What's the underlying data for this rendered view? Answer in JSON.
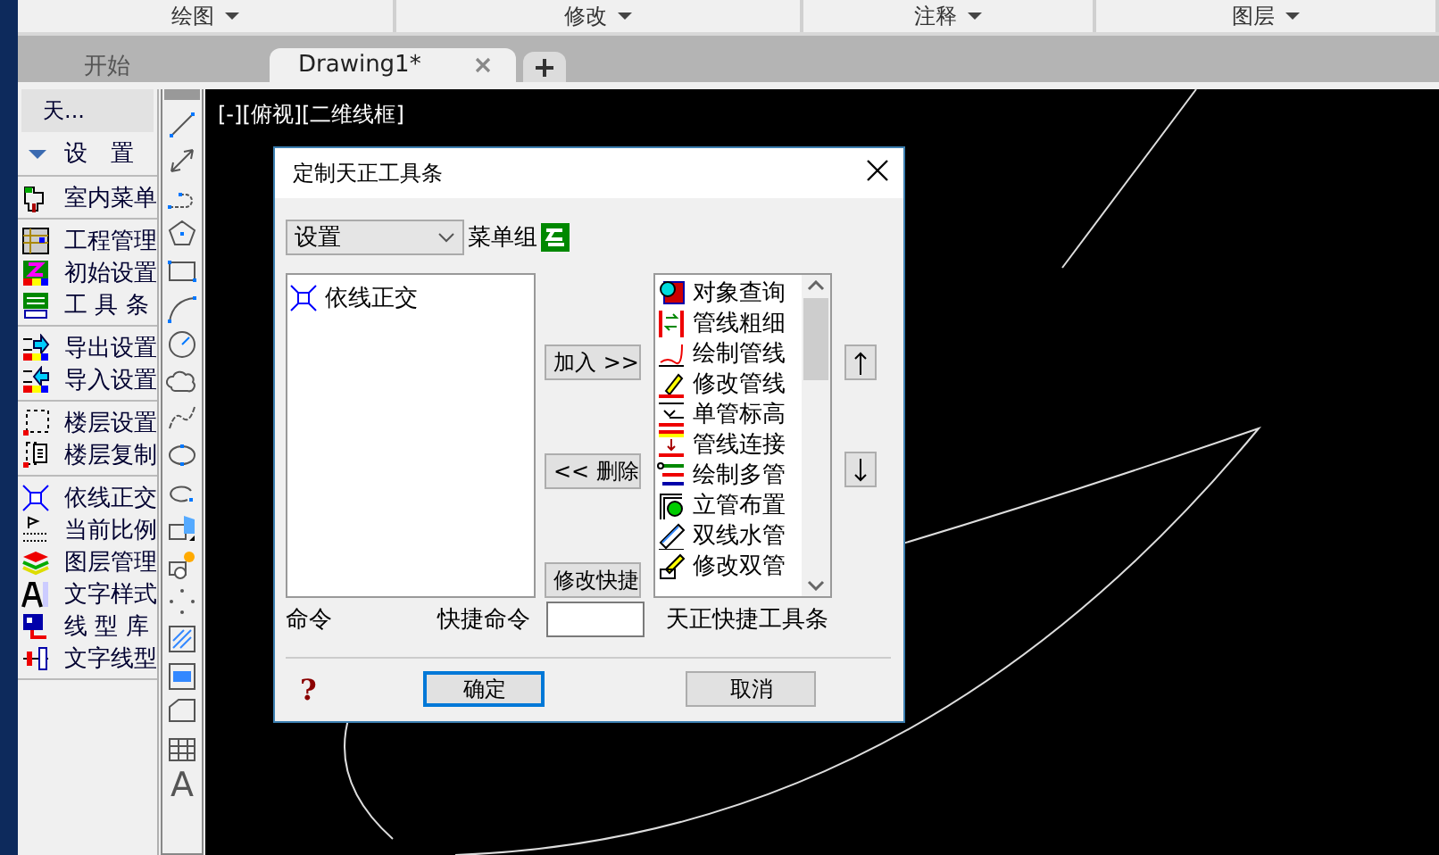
{
  "ribbon_panels": [
    {
      "label": "绘图"
    },
    {
      "label": "修改"
    },
    {
      "label": "注释"
    },
    {
      "label": "图层"
    }
  ],
  "file_tabs": [
    {
      "label": "开始",
      "selected": false
    },
    {
      "label": "Drawing1*",
      "selected": true
    }
  ],
  "side_panel": {
    "title": "天...",
    "header": "设　置",
    "groups": [
      [
        "室内菜单"
      ],
      [
        "工程管理",
        "初始设置",
        "工 具 条"
      ],
      [
        "导出设置",
        "导入设置"
      ],
      [
        "楼层设置",
        "楼层复制"
      ],
      [
        "依线正交",
        "当前比例",
        "图层管理",
        "文字样式",
        "线 型 库",
        "文字线型"
      ]
    ]
  },
  "draw_toolbar": {
    "text_tool": "A"
  },
  "viewport_label": "[-][俯视][二维线框]",
  "dialog": {
    "title": "定制天正工具条",
    "menu_group_value": "设置",
    "menu_group_label": "菜单组",
    "toolbar_commands": [
      {
        "label": "依线正交",
        "selected": false
      }
    ],
    "add_button": "加入 >>",
    "remove_button": "<< 删除",
    "edit_shortcut_button": "修改快捷",
    "available_commands": [
      "对象查询",
      "管线粗细",
      "绘制管线",
      "修改管线",
      "单管标高",
      "管线连接",
      "绘制多管",
      "立管布置",
      "双线水管",
      "修改双管"
    ],
    "command_label": "命令",
    "shortcut_label": "快捷命令",
    "toolbar_name": "天正快捷工具条",
    "help": "?",
    "ok_button": "确定",
    "cancel_button": "取消"
  }
}
